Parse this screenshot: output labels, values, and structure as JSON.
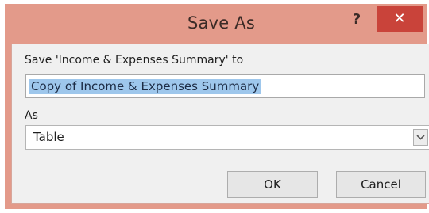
{
  "dialog": {
    "title": "Save As",
    "help_label": "?",
    "close_label": "✕"
  },
  "save": {
    "label": "Save 'Income & Expenses Summary' to",
    "name_value": "Copy of Income & Expenses Summary"
  },
  "as": {
    "label": "As",
    "selected": "Table"
  },
  "buttons": {
    "ok": "OK",
    "cancel": "Cancel"
  }
}
